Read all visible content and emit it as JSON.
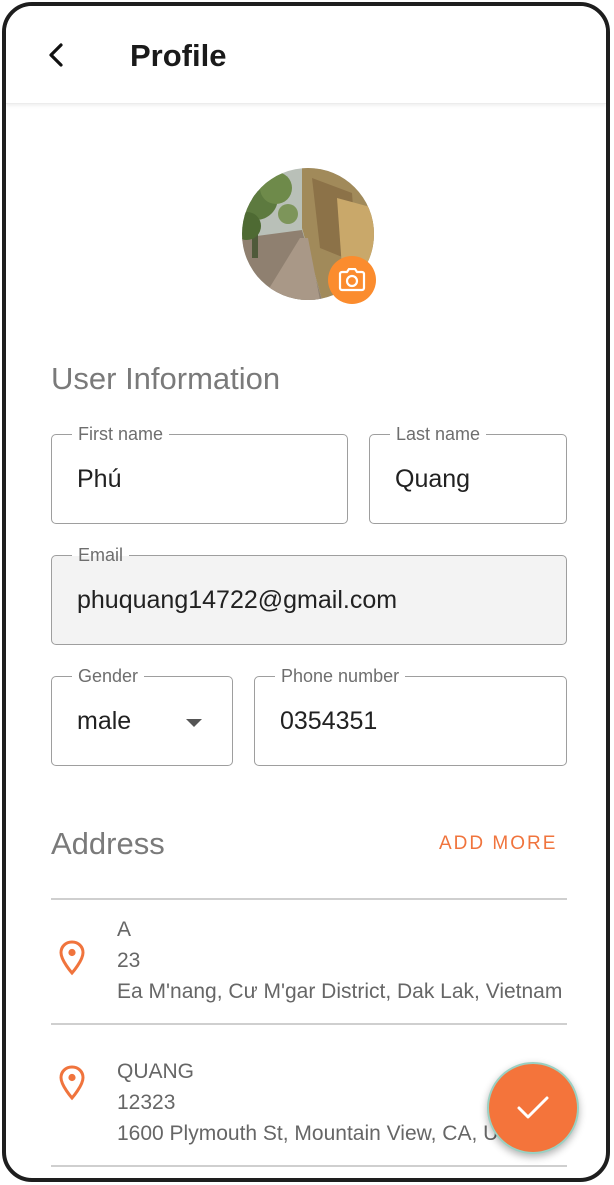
{
  "header": {
    "title": "Profile"
  },
  "icons": {
    "back": "chevron-left-icon",
    "camera": "camera-icon",
    "pin": "location-pin-icon",
    "check": "check-icon",
    "dropdown": "caret-down-icon"
  },
  "colors": {
    "accent": "#f4743b",
    "camera": "#fb8c2e"
  },
  "user_info": {
    "section_title": "User Information",
    "first_name": {
      "label": "First name",
      "value": "Phú"
    },
    "last_name": {
      "label": "Last name",
      "value": "Quang"
    },
    "email": {
      "label": "Email",
      "value": "phuquang14722@gmail.com"
    },
    "gender": {
      "label": "Gender",
      "value": "male"
    },
    "phone": {
      "label": "Phone number",
      "value": "0354351"
    }
  },
  "address": {
    "section_title": "Address",
    "add_more": "ADD MORE",
    "items": [
      {
        "name": "A",
        "phone": "23",
        "address": " Ea M'nang, Cư M'gar District, Dak Lak, Vietnam"
      },
      {
        "name": "QUANG",
        "phone": "12323",
        "address": "1600 Plymouth St, Mountain View, CA, USA"
      }
    ]
  }
}
